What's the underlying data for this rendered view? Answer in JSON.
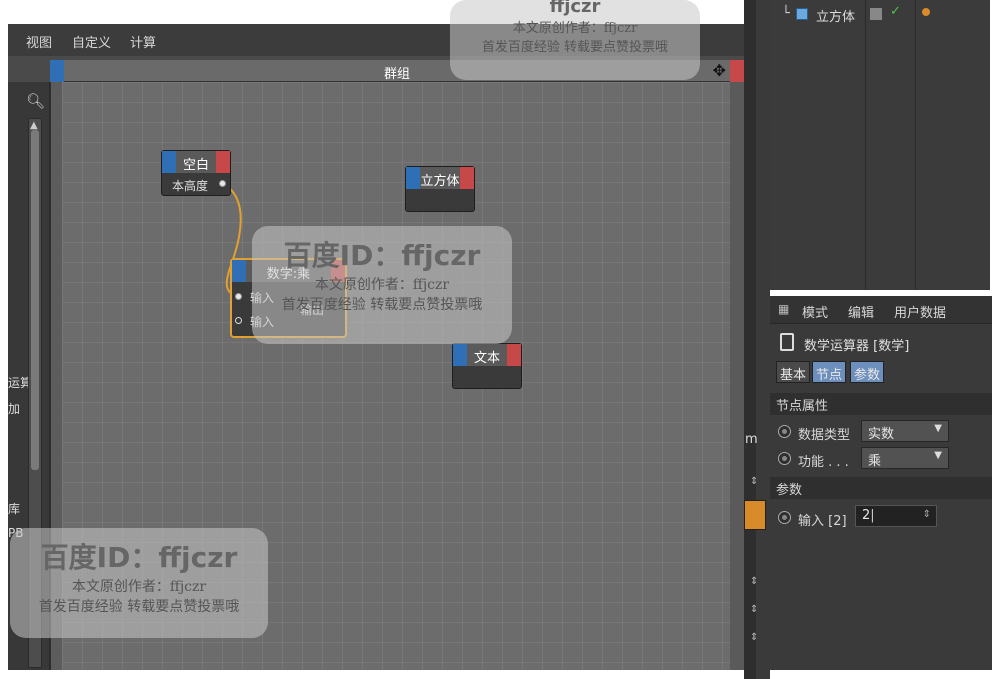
{
  "menubar": {
    "items": [
      "视图",
      "自定义",
      "计算"
    ]
  },
  "group": {
    "title": "群组",
    "resize_glyph": "✥"
  },
  "nodes": {
    "null": {
      "title": "空白",
      "port_out": "本高度"
    },
    "cube": {
      "title": "立方体"
    },
    "math": {
      "title": "数学:乘",
      "port_in1": "输入",
      "port_in2": "输入",
      "port_out": "输出"
    },
    "text": {
      "title": "文本"
    }
  },
  "side_panel": {
    "labels": [
      "运算",
      "加",
      "库",
      "PB"
    ]
  },
  "right_top": {
    "tree_item": "立方体",
    "tree_prefix": "└"
  },
  "attributes": {
    "tabs": [
      "模式",
      "编辑",
      "用户数据"
    ],
    "object_title": "数学运算器 [数学]",
    "sub_tabs": [
      "基本",
      "节点",
      "参数"
    ],
    "section_node": "节点属性",
    "data_type_label": "数据类型",
    "data_type_value": "实数",
    "function_label": "功能 . . .",
    "function_value": "乘",
    "section_params": "参数",
    "input_label": "输入 [2]",
    "input_value": "2",
    "side_letter": "m"
  },
  "watermark": {
    "id_text": "百度ID：ffjczr",
    "author": "本文原创作者：ffjczr",
    "note": "首发百度经验 转载要点赞投票哦",
    "top_partial": "ffjczr"
  },
  "colors": {
    "port_blue": "#2e6fb5",
    "port_red": "#c64848",
    "wire": "#e2a030"
  }
}
